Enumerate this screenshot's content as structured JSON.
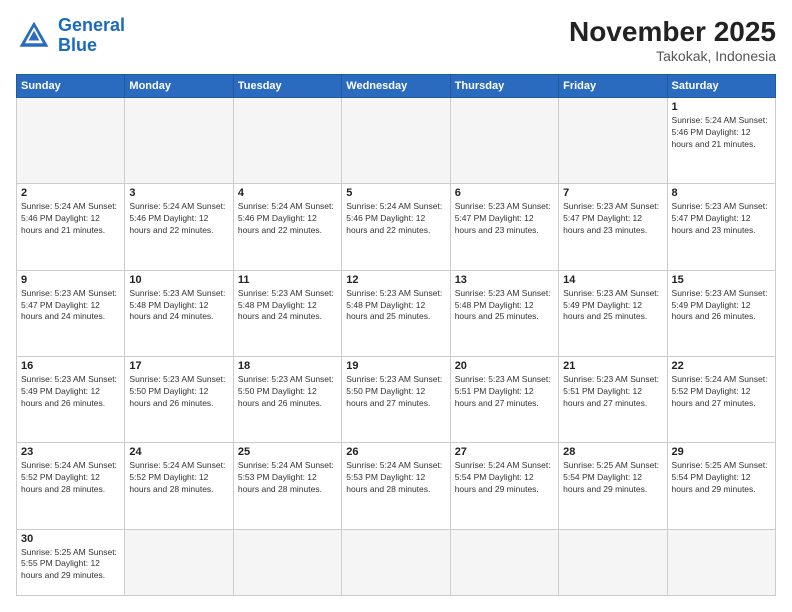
{
  "header": {
    "logo_general": "General",
    "logo_blue": "Blue",
    "month_title": "November 2025",
    "location": "Takokak, Indonesia"
  },
  "days_of_week": [
    "Sunday",
    "Monday",
    "Tuesday",
    "Wednesday",
    "Thursday",
    "Friday",
    "Saturday"
  ],
  "weeks": [
    [
      {
        "day": "",
        "info": ""
      },
      {
        "day": "",
        "info": ""
      },
      {
        "day": "",
        "info": ""
      },
      {
        "day": "",
        "info": ""
      },
      {
        "day": "",
        "info": ""
      },
      {
        "day": "",
        "info": ""
      },
      {
        "day": "1",
        "info": "Sunrise: 5:24 AM\nSunset: 5:46 PM\nDaylight: 12 hours\nand 21 minutes."
      }
    ],
    [
      {
        "day": "2",
        "info": "Sunrise: 5:24 AM\nSunset: 5:46 PM\nDaylight: 12 hours\nand 21 minutes."
      },
      {
        "day": "3",
        "info": "Sunrise: 5:24 AM\nSunset: 5:46 PM\nDaylight: 12 hours\nand 22 minutes."
      },
      {
        "day": "4",
        "info": "Sunrise: 5:24 AM\nSunset: 5:46 PM\nDaylight: 12 hours\nand 22 minutes."
      },
      {
        "day": "5",
        "info": "Sunrise: 5:24 AM\nSunset: 5:46 PM\nDaylight: 12 hours\nand 22 minutes."
      },
      {
        "day": "6",
        "info": "Sunrise: 5:23 AM\nSunset: 5:47 PM\nDaylight: 12 hours\nand 23 minutes."
      },
      {
        "day": "7",
        "info": "Sunrise: 5:23 AM\nSunset: 5:47 PM\nDaylight: 12 hours\nand 23 minutes."
      },
      {
        "day": "8",
        "info": "Sunrise: 5:23 AM\nSunset: 5:47 PM\nDaylight: 12 hours\nand 23 minutes."
      }
    ],
    [
      {
        "day": "9",
        "info": "Sunrise: 5:23 AM\nSunset: 5:47 PM\nDaylight: 12 hours\nand 24 minutes."
      },
      {
        "day": "10",
        "info": "Sunrise: 5:23 AM\nSunset: 5:48 PM\nDaylight: 12 hours\nand 24 minutes."
      },
      {
        "day": "11",
        "info": "Sunrise: 5:23 AM\nSunset: 5:48 PM\nDaylight: 12 hours\nand 24 minutes."
      },
      {
        "day": "12",
        "info": "Sunrise: 5:23 AM\nSunset: 5:48 PM\nDaylight: 12 hours\nand 25 minutes."
      },
      {
        "day": "13",
        "info": "Sunrise: 5:23 AM\nSunset: 5:48 PM\nDaylight: 12 hours\nand 25 minutes."
      },
      {
        "day": "14",
        "info": "Sunrise: 5:23 AM\nSunset: 5:49 PM\nDaylight: 12 hours\nand 25 minutes."
      },
      {
        "day": "15",
        "info": "Sunrise: 5:23 AM\nSunset: 5:49 PM\nDaylight: 12 hours\nand 26 minutes."
      }
    ],
    [
      {
        "day": "16",
        "info": "Sunrise: 5:23 AM\nSunset: 5:49 PM\nDaylight: 12 hours\nand 26 minutes."
      },
      {
        "day": "17",
        "info": "Sunrise: 5:23 AM\nSunset: 5:50 PM\nDaylight: 12 hours\nand 26 minutes."
      },
      {
        "day": "18",
        "info": "Sunrise: 5:23 AM\nSunset: 5:50 PM\nDaylight: 12 hours\nand 26 minutes."
      },
      {
        "day": "19",
        "info": "Sunrise: 5:23 AM\nSunset: 5:50 PM\nDaylight: 12 hours\nand 27 minutes."
      },
      {
        "day": "20",
        "info": "Sunrise: 5:23 AM\nSunset: 5:51 PM\nDaylight: 12 hours\nand 27 minutes."
      },
      {
        "day": "21",
        "info": "Sunrise: 5:23 AM\nSunset: 5:51 PM\nDaylight: 12 hours\nand 27 minutes."
      },
      {
        "day": "22",
        "info": "Sunrise: 5:24 AM\nSunset: 5:52 PM\nDaylight: 12 hours\nand 27 minutes."
      }
    ],
    [
      {
        "day": "23",
        "info": "Sunrise: 5:24 AM\nSunset: 5:52 PM\nDaylight: 12 hours\nand 28 minutes."
      },
      {
        "day": "24",
        "info": "Sunrise: 5:24 AM\nSunset: 5:52 PM\nDaylight: 12 hours\nand 28 minutes."
      },
      {
        "day": "25",
        "info": "Sunrise: 5:24 AM\nSunset: 5:53 PM\nDaylight: 12 hours\nand 28 minutes."
      },
      {
        "day": "26",
        "info": "Sunrise: 5:24 AM\nSunset: 5:53 PM\nDaylight: 12 hours\nand 28 minutes."
      },
      {
        "day": "27",
        "info": "Sunrise: 5:24 AM\nSunset: 5:54 PM\nDaylight: 12 hours\nand 29 minutes."
      },
      {
        "day": "28",
        "info": "Sunrise: 5:25 AM\nSunset: 5:54 PM\nDaylight: 12 hours\nand 29 minutes."
      },
      {
        "day": "29",
        "info": "Sunrise: 5:25 AM\nSunset: 5:54 PM\nDaylight: 12 hours\nand 29 minutes."
      }
    ],
    [
      {
        "day": "30",
        "info": "Sunrise: 5:25 AM\nSunset: 5:55 PM\nDaylight: 12 hours\nand 29 minutes."
      },
      {
        "day": "",
        "info": ""
      },
      {
        "day": "",
        "info": ""
      },
      {
        "day": "",
        "info": ""
      },
      {
        "day": "",
        "info": ""
      },
      {
        "day": "",
        "info": ""
      },
      {
        "day": "",
        "info": ""
      }
    ]
  ]
}
